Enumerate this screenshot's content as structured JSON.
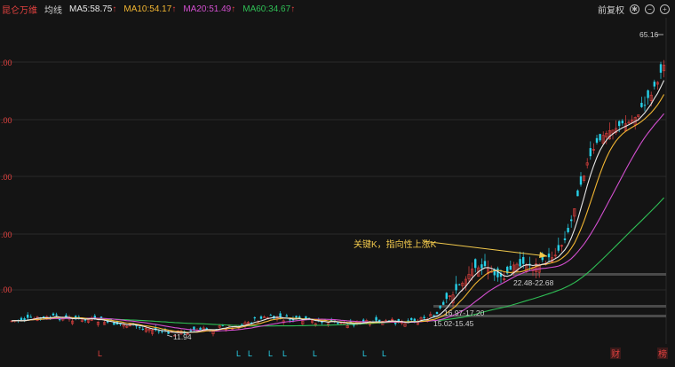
{
  "header": {
    "stock_name": "昆仑万维",
    "indicator": "均线",
    "ma5": "MA5:58.75",
    "ma10": "MA10:54.17",
    "ma20": "MA20:51.49",
    "ma60": "MA60:34.67",
    "adjust": "前复权"
  },
  "y_ticks": [
    ".00",
    ".00",
    ".00",
    ".00",
    ".00"
  ],
  "annotations": {
    "high": "65.16",
    "low": "11.94",
    "key_text": "关键K，指向性上涨K",
    "zone1": "22.48-22.68",
    "zone2": "16.97-17.20",
    "zone3": "15.02-15.45"
  },
  "markers": {
    "L": "L",
    "cai": "财",
    "bang": "榜"
  },
  "colors": {
    "up": "#e0413f",
    "down": "#27d0e8",
    "ma5": "#e8e8e8",
    "ma10": "#f2b632",
    "ma20": "#d24fcf",
    "ma60": "#2fbf55"
  }
}
